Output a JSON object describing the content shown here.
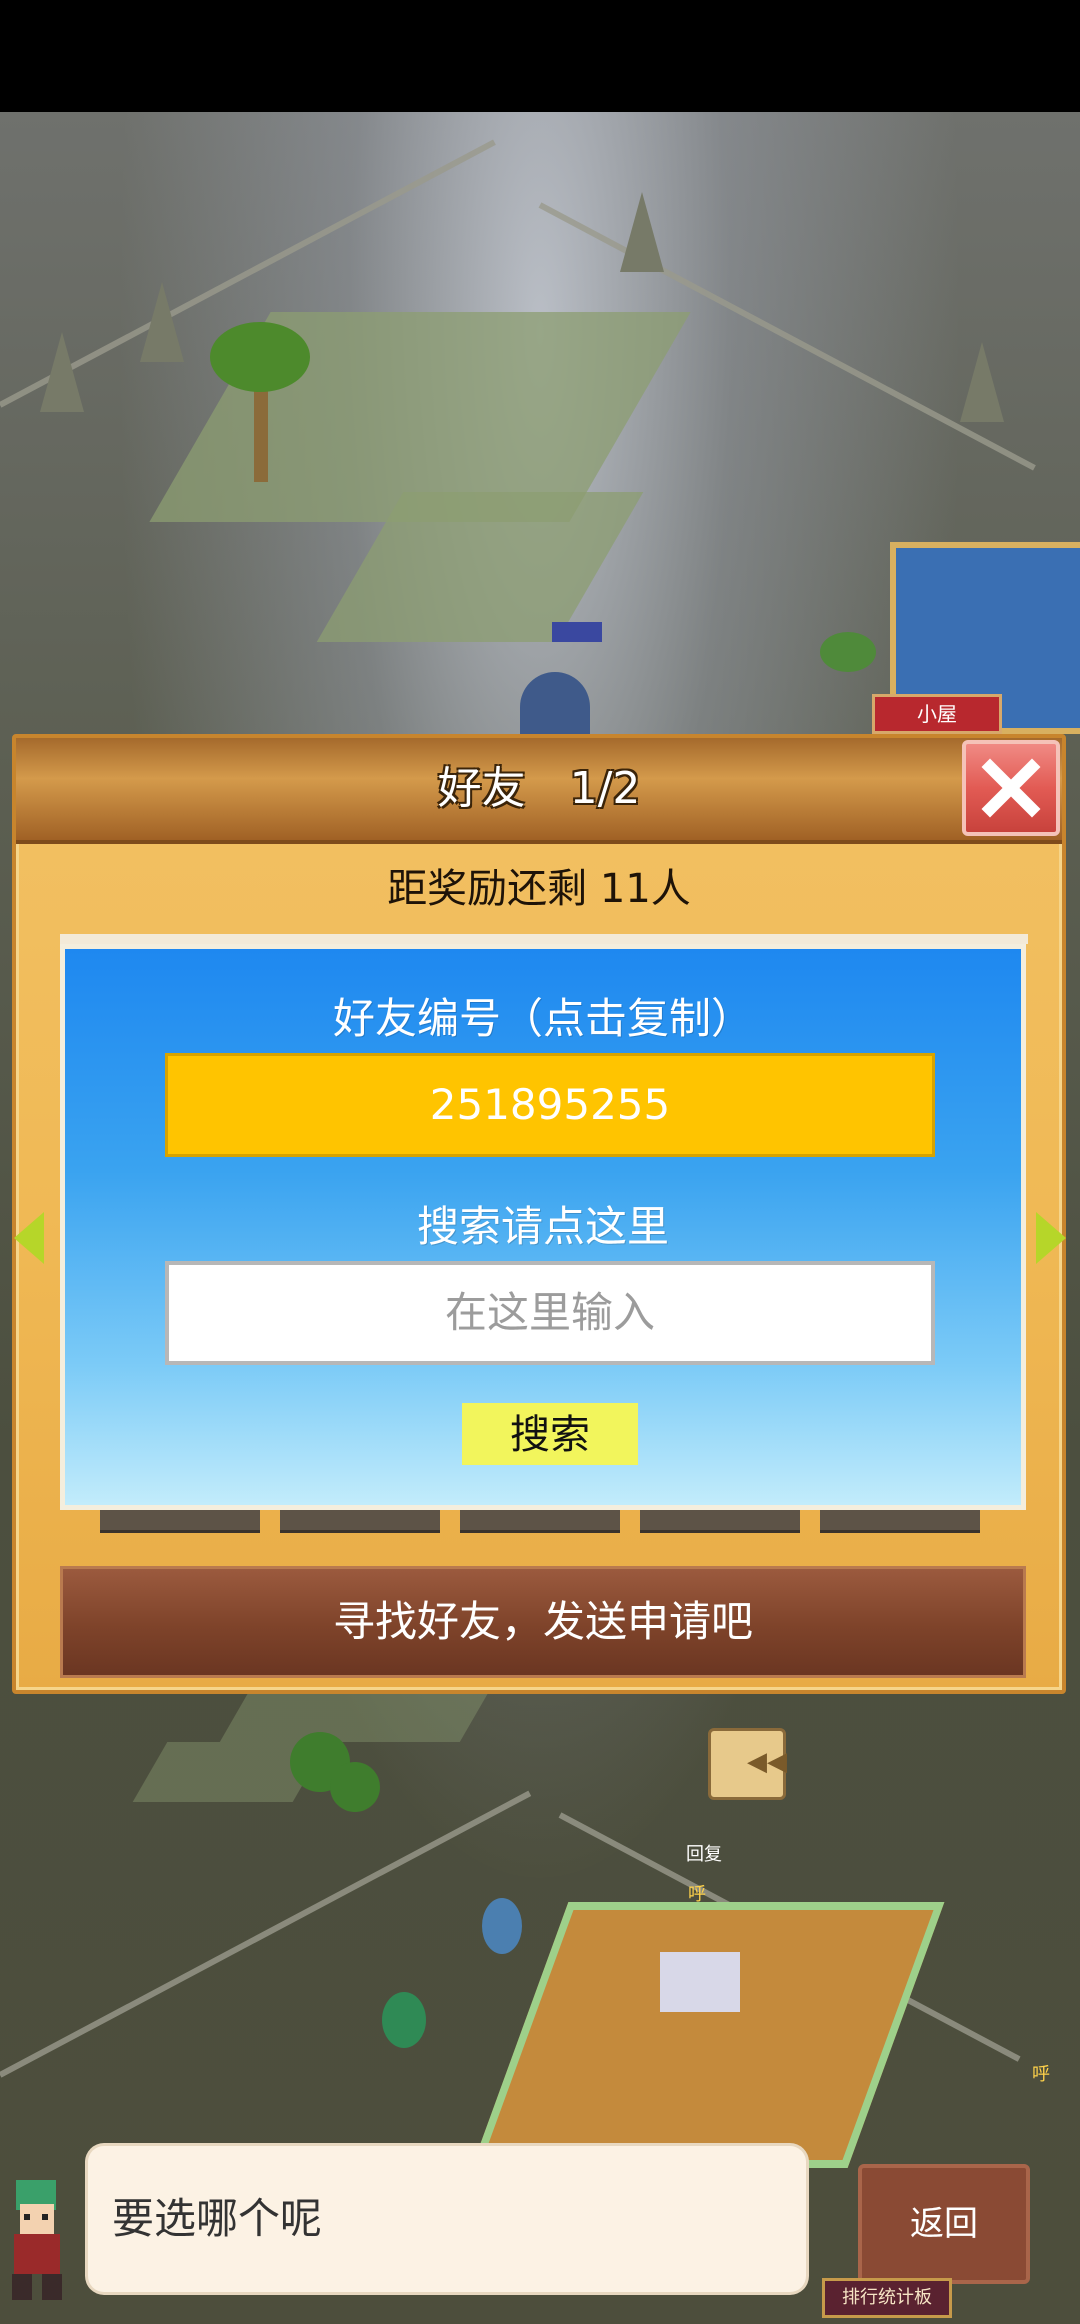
{
  "dialog": {
    "title": "好友　1/2",
    "reward_line": "距奖励还剩 11人",
    "friend_id_label": "好友编号（点击复制）",
    "friend_id": "251895255",
    "search_label": "搜索请点这里",
    "search_placeholder": "在这里输入",
    "search_button": "搜索",
    "find_friends_button": "寻找好友，发送申请吧"
  },
  "speech": {
    "text": "要选哪个呢"
  },
  "buttons": {
    "back": "返回",
    "ranking": "排行统计板"
  },
  "map": {
    "cabin_label": "小屋",
    "recover_label": "回复",
    "exclaim_label": "呼",
    "exclaim_label_2": "呼"
  },
  "colors": {
    "panel_blue": "#1e88f0",
    "id_box_yellow": "#ffc400",
    "search_button_yellow": "#f2f55c",
    "close_red": "#e25b54",
    "find_button_brown": "#7e432a",
    "dialog_gold": "#f0b955"
  },
  "icons": [
    "close-icon",
    "arrow-left-icon",
    "arrow-right-icon",
    "character-avatar-icon",
    "rewind-icon"
  ]
}
